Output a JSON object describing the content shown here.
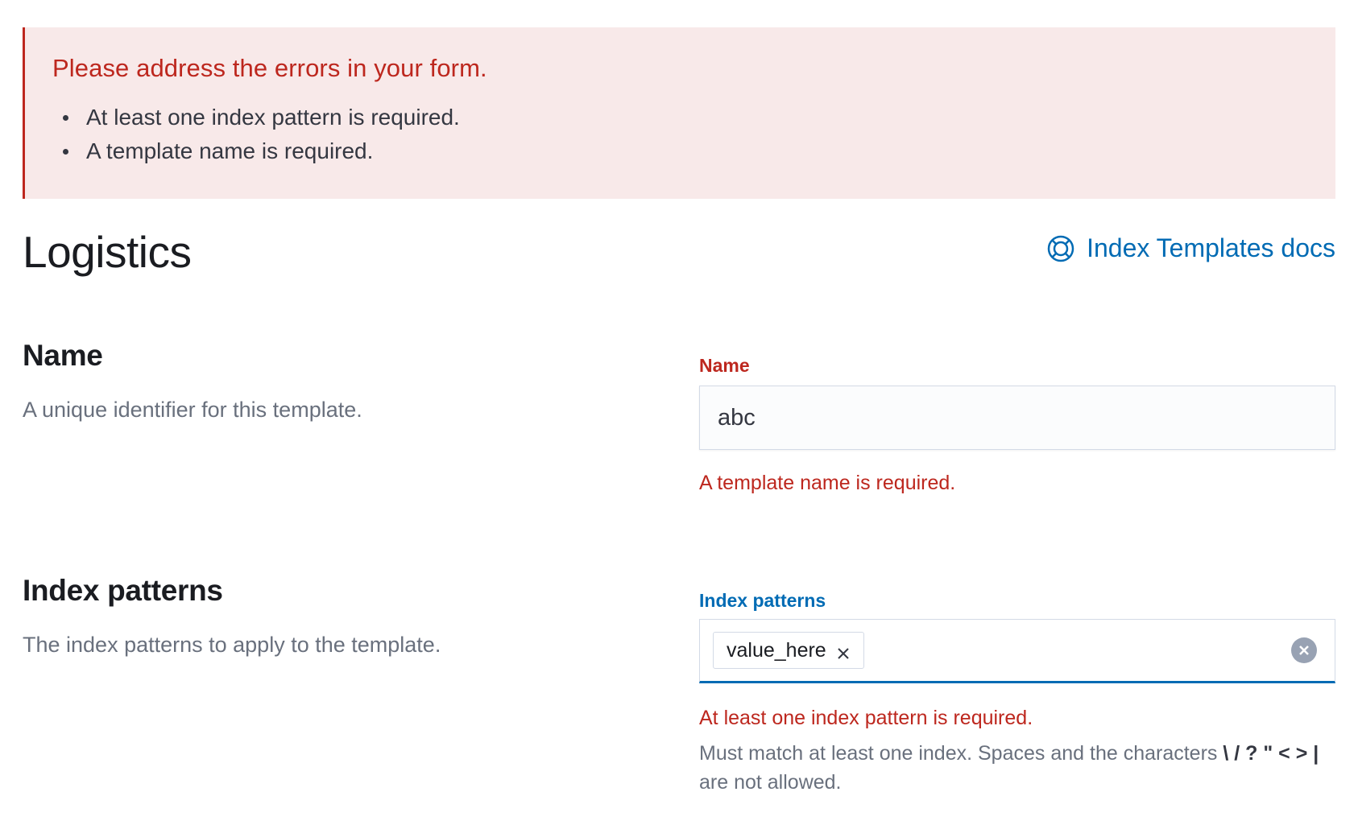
{
  "callout": {
    "title": "Please address the errors in your form.",
    "errors": [
      "At least one index pattern is required.",
      "A template name is required."
    ]
  },
  "page": {
    "title": "Logistics",
    "docs_link": "Index Templates docs",
    "docs_icon": "lifebuoy-icon"
  },
  "name_section": {
    "title": "Name",
    "description": "A unique identifier for this template.",
    "field_label": "Name",
    "value": "abc",
    "error": "A template name is required."
  },
  "index_section": {
    "title": "Index patterns",
    "description": "The index patterns to apply to the template.",
    "field_label": "Index patterns",
    "pills": [
      "value_here"
    ],
    "error": "At least one index pattern is required.",
    "help_prefix": "Must match at least one index. Spaces and the characters",
    "help_chars": "\\ / ? \" < > |",
    "help_suffix": "are not allowed."
  },
  "colors": {
    "danger": "#bd271e",
    "primary": "#006bb4",
    "callout_bg": "#f8e9e9",
    "subdued_text": "#69707d"
  }
}
